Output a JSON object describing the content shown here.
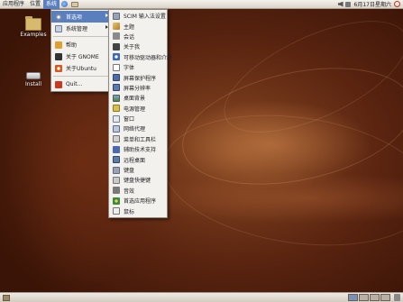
{
  "top_panel": {
    "menus": [
      "应用程序",
      "位置",
      "系统"
    ],
    "clock": "6月17日星期六",
    "icons": [
      "globe-icon",
      "mail-icon",
      "volume-icon",
      "network-icon",
      "power-icon"
    ]
  },
  "desktop_icons": [
    {
      "label": "Examples",
      "icon": "folder-icon"
    },
    {
      "label": "Install",
      "icon": "disk-icon"
    }
  ],
  "system_menu": {
    "items": [
      {
        "label": "首选项",
        "icon": "gear-icon",
        "submenu": true
      },
      {
        "label": "系统管理",
        "icon": "admin-icon",
        "submenu": true
      },
      {
        "label": "帮助",
        "icon": "help-icon"
      },
      {
        "label": "关于 GNOME",
        "icon": "gnome-foot-icon"
      },
      {
        "label": "关于Ubuntu",
        "icon": "ubuntu-icon"
      },
      {
        "label": "Quit...",
        "icon": "quit-icon"
      }
    ]
  },
  "prefs_menu": {
    "items": [
      {
        "label": "SCIM 输入法设置",
        "icon": "keyboard-icon"
      },
      {
        "label": "主题",
        "icon": "theme-icon"
      },
      {
        "label": "会话",
        "icon": "session-icon"
      },
      {
        "label": "关于我",
        "icon": "about-me-icon"
      },
      {
        "label": "可移动驱动器和介质",
        "icon": "accessibility-icon"
      },
      {
        "label": "字体",
        "icon": "font-icon"
      },
      {
        "label": "屏幕保护程序",
        "icon": "screensaver-icon"
      },
      {
        "label": "屏幕分辨率",
        "icon": "resolution-icon"
      },
      {
        "label": "桌面背景",
        "icon": "wallpaper-icon"
      },
      {
        "label": "电源管理",
        "icon": "power-management-icon"
      },
      {
        "label": "窗口",
        "icon": "window-icon"
      },
      {
        "label": "网络代理",
        "icon": "proxy-icon"
      },
      {
        "label": "菜单和工具栏",
        "icon": "panel-icon"
      },
      {
        "label": "辅助技术支持",
        "icon": "assistive-icon"
      },
      {
        "label": "远程桌面",
        "icon": "remote-desktop-icon"
      },
      {
        "label": "键盘",
        "icon": "keyboard-icon"
      },
      {
        "label": "键盘快捷键",
        "icon": "shortcut-icon"
      },
      {
        "label": "音效",
        "icon": "sound-icon"
      },
      {
        "label": "首选应用程序",
        "icon": "preferred-apps-icon"
      },
      {
        "label": "鼠标",
        "icon": "mouse-icon"
      }
    ]
  },
  "bottom_panel": {
    "icons": [
      "show-desktop-icon",
      "workspace-icon",
      "trash-icon"
    ],
    "workspace_count": 4,
    "active_workspace": 1
  }
}
